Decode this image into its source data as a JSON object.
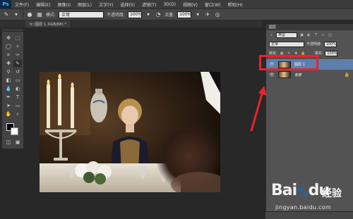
{
  "menubar": {
    "logo": "Ps",
    "items": [
      "文件(F)",
      "编辑(E)",
      "图像(I)",
      "图层(L)",
      "文字(Y)",
      "选择(S)",
      "滤镜(T)",
      "3D(D)",
      "视图(V)",
      "窗口(W)",
      "帮助(H)"
    ]
  },
  "options": {
    "mode_label": "模式:",
    "mode_value": "正常",
    "opacity_label": "不透明度:",
    "opacity_value": "100%",
    "flow_label": "流量:",
    "flow_value": "100%"
  },
  "document": {
    "tab_title": "fc (图层 1, RGB/8#) *"
  },
  "layers_panel": {
    "tab_label": "图层",
    "filter_value": "类型",
    "blend_mode": "正常",
    "opacity_label": "不透明度:",
    "opacity_value": "100%",
    "lock_label": "锁定:",
    "fill_label": "填充:",
    "fill_value": "100%",
    "layers": [
      {
        "name": "图层 1",
        "selected": true
      },
      {
        "name": "背景",
        "selected": false,
        "locked": true
      }
    ]
  },
  "colors": {
    "highlight": "#e8242a",
    "selected_layer": "#5c7fad",
    "arrow": "#e8242a"
  },
  "watermark": {
    "brand": "Bai",
    "brand_suffix": "du",
    "jingyan": "经验",
    "url": "jingyan.baidu.com"
  }
}
